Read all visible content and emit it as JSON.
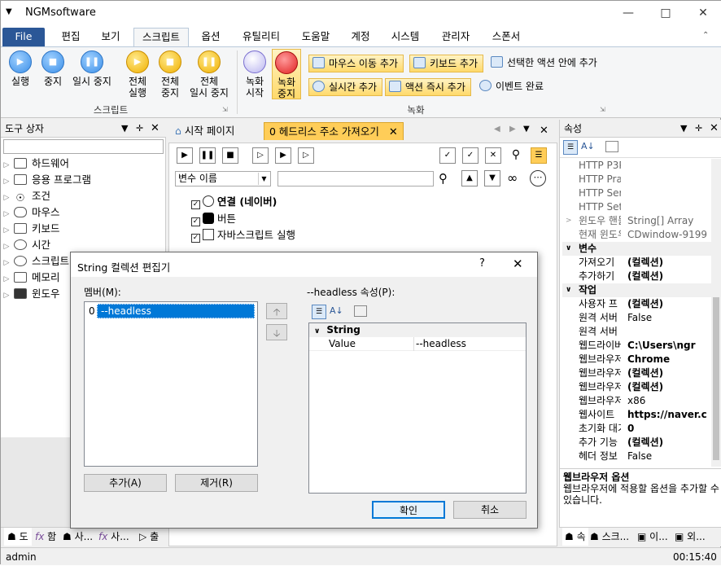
{
  "app": {
    "title": "NGMsoftware"
  },
  "menu": {
    "tabs": [
      "File",
      "편집",
      "보기",
      "스크립트",
      "옵션",
      "유틸리티",
      "도움말",
      "계정",
      "시스템",
      "관리자",
      "스폰서"
    ]
  },
  "ribbon": {
    "script_buttons": [
      {
        "label1": "실행",
        "label2": "",
        "icon": "play-icon"
      },
      {
        "label1": "중지",
        "label2": "",
        "icon": "stop-icon"
      },
      {
        "label1": "일시 중지",
        "label2": "",
        "icon": "pause-icon"
      },
      {
        "label1": "전체",
        "label2": "실행",
        "icon": "play-all-icon"
      },
      {
        "label1": "전체",
        "label2": "중지",
        "icon": "stop-all-icon"
      },
      {
        "label1": "전체",
        "label2": "일시 중지",
        "icon": "pause-all-icon"
      }
    ],
    "script_group": "스크립트",
    "record_buttons": [
      {
        "label1": "녹화",
        "label2": "시작",
        "icon": "record-start-icon"
      },
      {
        "label1": "녹화",
        "label2": "중지",
        "icon": "record-stop-icon"
      }
    ],
    "record_small": [
      "마우스 이동 추가",
      "키보드 추가",
      "선택한 액션 안에 추가",
      "실시간 추가",
      "액션 즉시 추가",
      "이벤트 완료"
    ],
    "record_group": "녹화"
  },
  "toolbox": {
    "title": "도구 상자",
    "search_value": "",
    "items": [
      "하드웨어",
      "응용 프로그램",
      "조건",
      "마우스",
      "키보드",
      "시간",
      "스크립트",
      "메모리",
      "윈도우"
    ]
  },
  "doc": {
    "tabs": [
      "시작 페이지",
      "0 헤드리스 주소 가져오기"
    ],
    "var_select": "변수 이름",
    "actions": [
      "연결 (네이버)",
      "버튼",
      "자바스크립트 실행"
    ]
  },
  "props": {
    "title": "속성",
    "rows": [
      {
        "k": "HTTP P3P",
        "v": "",
        "type": "grey"
      },
      {
        "k": "HTTP Pra",
        "v": "",
        "type": "grey"
      },
      {
        "k": "HTTP Ser",
        "v": "",
        "type": "grey"
      },
      {
        "k": "HTTP Set",
        "v": "",
        "type": "grey"
      },
      {
        "k": "윈도우 핸들",
        "v": "String[] Array",
        "type": "grey"
      },
      {
        "k": "현재 윈도우",
        "v": "CDwindow-9199",
        "type": "grey"
      },
      {
        "k": "변수",
        "v": "",
        "type": "cat"
      },
      {
        "k": "가져오기",
        "v": "(컬렉션)",
        "type": "bold"
      },
      {
        "k": "추가하기",
        "v": "(컬렉션)",
        "type": "bold"
      },
      {
        "k": "작업",
        "v": "",
        "type": "cat"
      },
      {
        "k": "사용자 프",
        "v": "(컬렉션)",
        "type": "bold"
      },
      {
        "k": "원격 서버",
        "v": "False",
        "type": ""
      },
      {
        "k": "원격 서버",
        "v": "",
        "type": ""
      },
      {
        "k": "웹드라이버",
        "v": "C:\\Users\\ngr",
        "type": "bold"
      },
      {
        "k": "웹브라우저",
        "v": "Chrome",
        "type": "bold"
      },
      {
        "k": "웹브라우저",
        "v": "(컬렉션)",
        "type": "bold"
      },
      {
        "k": "웹브라우저",
        "v": "(컬렉션)",
        "type": "bold"
      },
      {
        "k": "웹브라우저",
        "v": "x86",
        "type": ""
      },
      {
        "k": "웹사이트",
        "v": "https://naver.c",
        "type": "bold"
      },
      {
        "k": "초기화 대기",
        "v": "0",
        "type": "bold"
      },
      {
        "k": "추가 기능",
        "v": "(컬렉션)",
        "type": "bold"
      },
      {
        "k": "헤더 정보",
        "v": "False",
        "type": ""
      }
    ],
    "desc_title": "웹브라우저 옵션",
    "desc_text": "웹브라우저에 적용할 옵션을 추가할 수 있습니다."
  },
  "bottom_tabs": [
    "도",
    "함",
    "사...",
    "사...",
    "출"
  ],
  "right_bottom_tabs": [
    "속",
    "스크...",
    "이...",
    "외..."
  ],
  "dialog": {
    "title": "String 컬렉션 편집기",
    "members_label": "멤버(M):",
    "member_index": "0",
    "member_value": "--headless",
    "props_label": "--headless 속성(P):",
    "cat": "String",
    "prop_key": "Value",
    "prop_val": "--headless",
    "add": "추가(A)",
    "remove": "제거(R)",
    "ok": "확인",
    "cancel": "취소",
    "help": "?"
  },
  "status": {
    "user": "admin",
    "time": "00:15:40"
  }
}
